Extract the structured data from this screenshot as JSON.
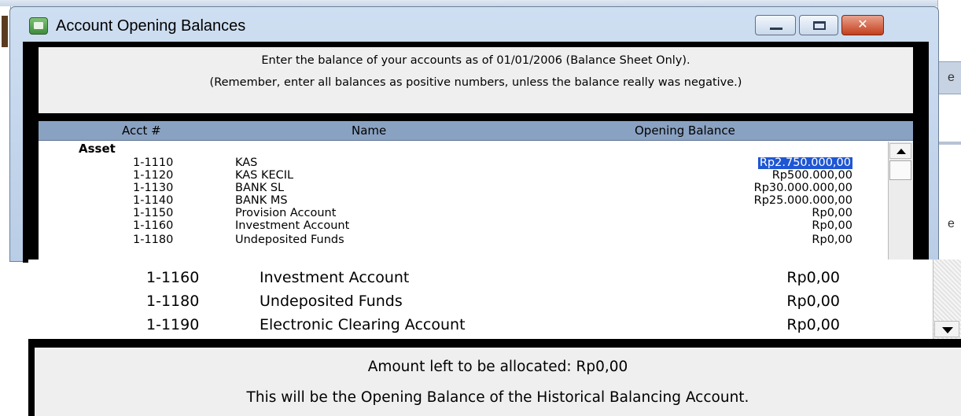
{
  "window": {
    "title": "Account Opening Balances",
    "close_glyph": "✕"
  },
  "instructions": {
    "line1": "Enter the balance of your accounts as of 01/01/2006 (Balance Sheet Only).",
    "line2": "(Remember, enter all balances as positive numbers, unless the balance really was negative.)"
  },
  "table": {
    "columns": [
      "Acct #",
      "Name",
      "Opening Balance"
    ],
    "group": "Asset",
    "rows": [
      {
        "acct": "1-1110",
        "name": "KAS",
        "balance": "Rp2.750.000,00",
        "selected": true
      },
      {
        "acct": "1-1120",
        "name": "KAS KECIL",
        "balance": "Rp500.000,00"
      },
      {
        "acct": "1-1130",
        "name": "BANK SL",
        "balance": "Rp30.000.000,00"
      },
      {
        "acct": "1-1140",
        "name": "BANK MS",
        "balance": "Rp25.000.000,00"
      },
      {
        "acct": "1-1150",
        "name": "Provision Account",
        "balance": "Rp0,00"
      },
      {
        "acct": "1-1160",
        "name": "Investment Account",
        "balance": "Rp0,00"
      },
      {
        "acct": "1-1180",
        "name": "Undeposited Funds",
        "balance": "Rp0,00"
      }
    ]
  },
  "zoom": {
    "rows": [
      {
        "acct": "1-1150",
        "name": "Provision Account",
        "balance": "Rp0,00"
      },
      {
        "acct": "1-1160",
        "name": "Investment Account",
        "balance": "Rp0,00"
      },
      {
        "acct": "1-1180",
        "name": "Undeposited Funds",
        "balance": "Rp0,00"
      },
      {
        "acct": "1-1190",
        "name": "Electronic Clearing Account",
        "balance": "Rp0,00"
      }
    ],
    "footer": {
      "amount_left": "Amount left to be allocated:  Rp0,00",
      "note": "This will be the Opening Balance of the Historical Balancing Account."
    }
  },
  "background": {
    "right_glyph_1": "e",
    "right_glyph_2": "e"
  }
}
